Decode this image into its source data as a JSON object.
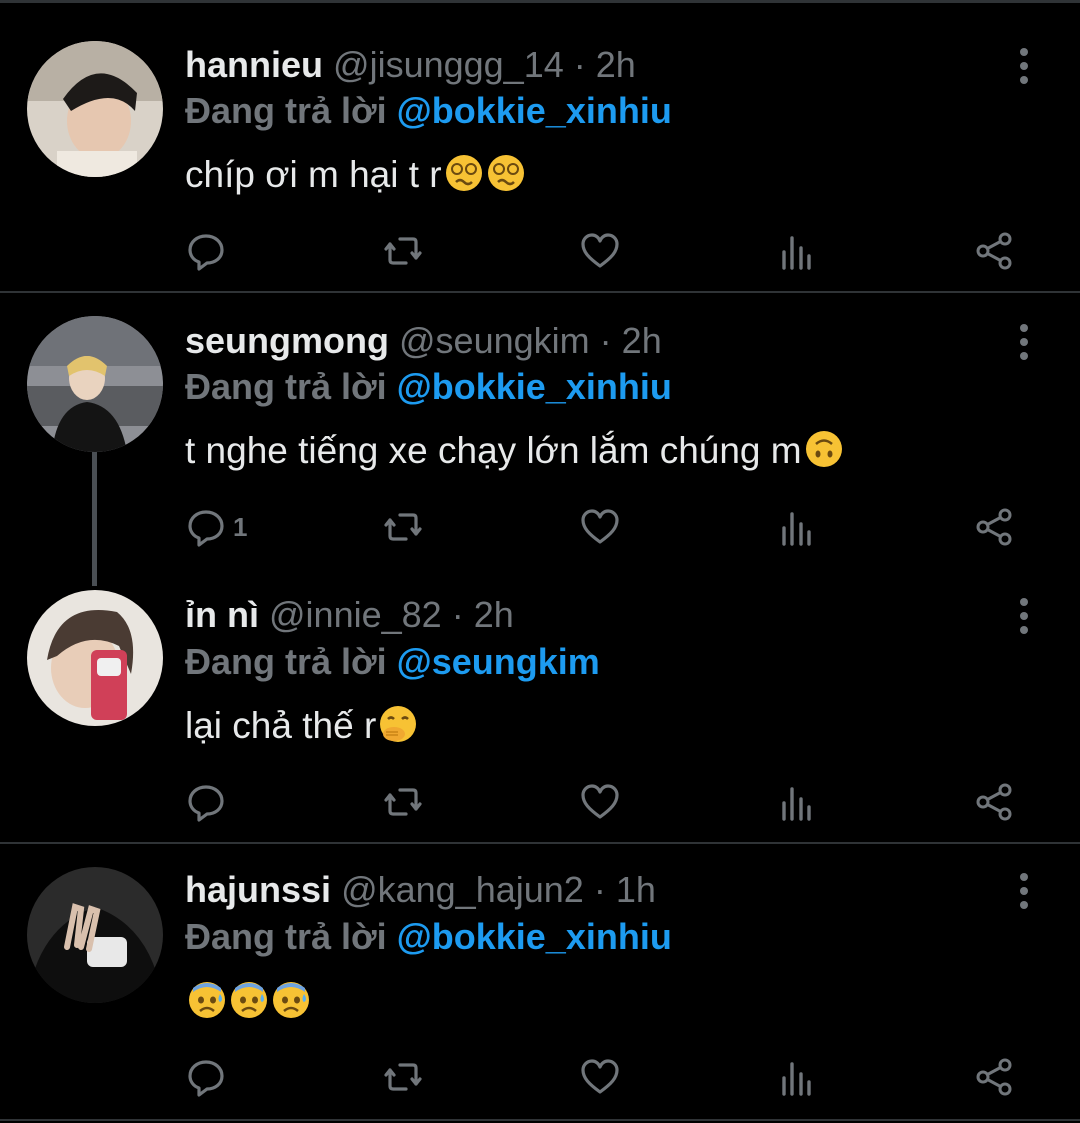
{
  "tweets": [
    {
      "name": "hannieu",
      "handle": "@jisunggg_14",
      "sep": "·",
      "time": "2h",
      "reply_prefix": "Đang trả lời",
      "reply_to": "@bokkie_xinhiu",
      "text": "chíp ơi m hại t r",
      "emojis": [
        "woozy-face",
        "woozy-face"
      ],
      "reply_count": "",
      "avatar_colors": [
        "#d9d2c8",
        "#1d1a18",
        "#c9a58c"
      ]
    },
    {
      "name": "seungmong",
      "handle": "@seungkim",
      "sep": "·",
      "time": "2h",
      "reply_prefix": "Đang trả lời",
      "reply_to": "@bokkie_xinhiu",
      "text": "t nghe tiếng xe chạy lớn lắm chúng m",
      "emojis": [
        "upside-down-face"
      ],
      "reply_count": "1",
      "avatar_colors": [
        "#8d8f95",
        "#141414",
        "#e2c36d"
      ]
    },
    {
      "name": "ỉn nì",
      "handle": "@innie_82",
      "sep": "·",
      "time": "2h",
      "reply_prefix": "Đang trả lời",
      "reply_to": "@seungkim",
      "text": "lại chả thế r",
      "emojis": [
        "face-with-hand-over-mouth"
      ],
      "reply_count": "",
      "avatar_colors": [
        "#e9e5df",
        "#4a3b33",
        "#d04058"
      ]
    },
    {
      "name": "hajunssi",
      "handle": "@kang_hajun2",
      "sep": "·",
      "time": "1h",
      "reply_prefix": "Đang trả lời",
      "reply_to": "@bokkie_xinhiu",
      "text": "",
      "emojis": [
        "anxious-face-with-sweat",
        "anxious-face-with-sweat",
        "anxious-face-with-sweat"
      ],
      "reply_count": "",
      "avatar_colors": [
        "#2b2b2b",
        "#0e0e0e",
        "#e8e8e8"
      ]
    }
  ],
  "colors": {
    "background": "#000000",
    "primary_text": "#e7e9ea",
    "secondary_text": "#71767b",
    "mention": "#1d9bf0",
    "divider": "#2f3336"
  },
  "icons": [
    "reply-icon",
    "retweet-icon",
    "like-icon",
    "analytics-icon",
    "share-icon",
    "more-icon"
  ]
}
